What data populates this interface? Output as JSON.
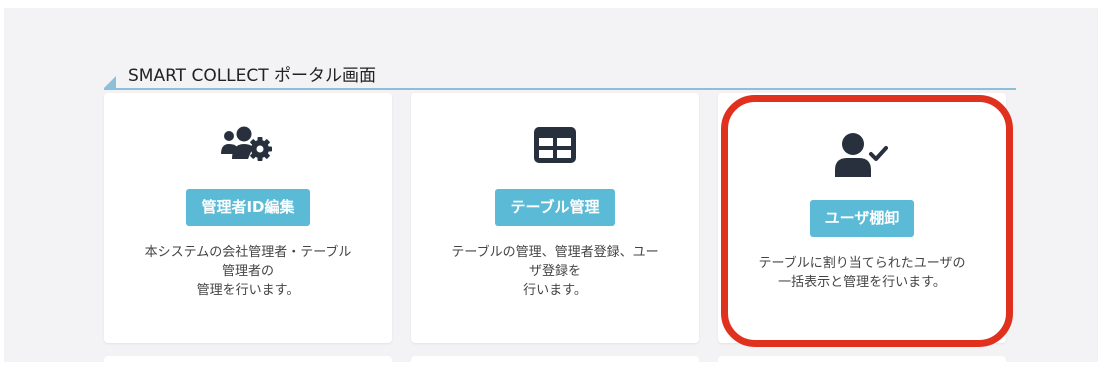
{
  "section": {
    "title": "SMART COLLECT ポータル画面"
  },
  "cards": [
    {
      "icon": "users-gear-icon",
      "button": "管理者ID編集",
      "desc": [
        "本システムの会社管理者・テーブル",
        "管理者の",
        "管理を行います。"
      ]
    },
    {
      "icon": "table-icon",
      "button": "テーブル管理",
      "desc": [
        "テーブルの管理、管理者登録、ユー",
        "ザ登録を",
        "行います。"
      ]
    },
    {
      "icon": "user-check-icon",
      "button": "ユーザ棚卸",
      "desc": [
        "テーブルに割り当てられたユーザの",
        "一括表示と管理を行います。"
      ]
    }
  ],
  "colors": {
    "accent": "#5bbad5",
    "highlight": "#e0301e",
    "icon": "#27303c"
  }
}
